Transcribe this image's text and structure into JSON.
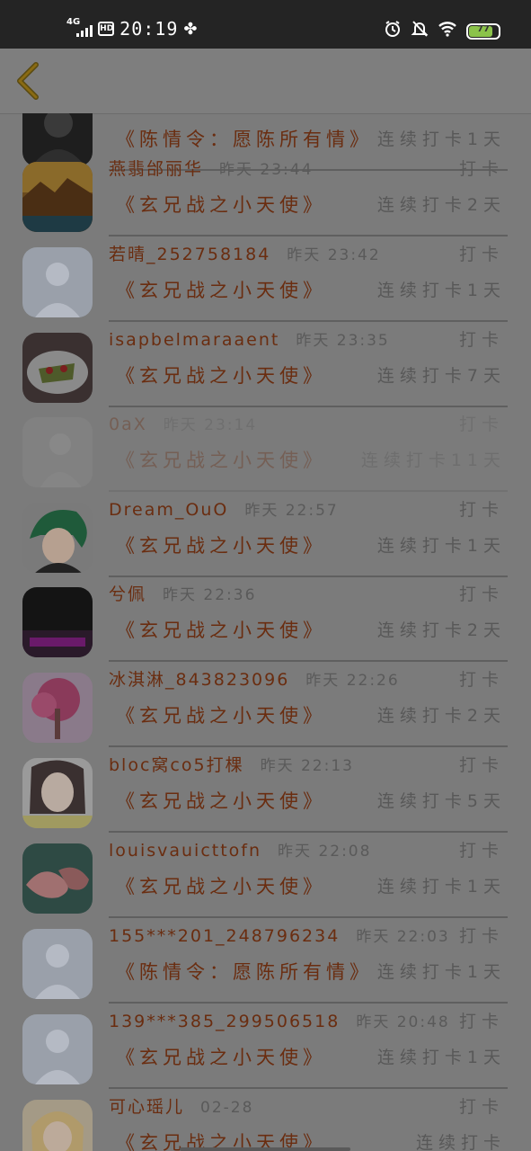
{
  "status_bar": {
    "network": "4G",
    "hd": "HD",
    "time": "20:19",
    "battery": "77",
    "battery_level": 0.77
  },
  "header": {
    "back_icon": "chevron-left-icon",
    "back_color": "#8a6a12"
  },
  "list": [
    {
      "avatar": "dark-portrait",
      "name": "",
      "time": "",
      "action": "",
      "book": "《陈情令：愿陈所有情》",
      "streak": "连续打卡1天"
    },
    {
      "avatar": "landscape-cliff",
      "name": "燕翡邰丽华",
      "time": "昨天 23:44",
      "action": "打卡",
      "book": "《玄兄战之小天使》",
      "streak": "连续打卡2天"
    },
    {
      "avatar": "default-user",
      "name": "若晴_252758184",
      "time": "昨天 23:42",
      "action": "打卡",
      "book": "《玄兄战之小天使》",
      "streak": "连续打卡1天"
    },
    {
      "avatar": "food-plate",
      "name": "isapbelmaraaent",
      "time": "昨天 23:35",
      "action": "打卡",
      "book": "《玄兄战之小天使》",
      "streak": "连续打卡7天"
    },
    {
      "avatar": "faded-figure",
      "name": "0aX",
      "time": "昨天 23:14",
      "action": "打卡",
      "book": "《玄兄战之小天使》",
      "streak": "连续打卡11天",
      "faded": true
    },
    {
      "avatar": "green-hair-anime",
      "name": "Dream_OuO",
      "time": "昨天 22:57",
      "action": "打卡",
      "book": "《玄兄战之小天使》",
      "streak": "连续打卡1天"
    },
    {
      "avatar": "night-scene",
      "name": "兮佩",
      "time": "昨天 22:36",
      "action": "打卡",
      "book": "《玄兄战之小天使》",
      "streak": "连续打卡2天"
    },
    {
      "avatar": "pink-tree",
      "name": "冰淇淋_843823096",
      "time": "昨天 22:26",
      "action": "打卡",
      "book": "《玄兄战之小天使》",
      "streak": "连续打卡2天"
    },
    {
      "avatar": "girl-face",
      "name": "bloc窝co5打棵",
      "time": "昨天 22:13",
      "action": "打卡",
      "book": "《玄兄战之小天使》",
      "streak": "连续打卡5天"
    },
    {
      "avatar": "flamingo",
      "name": "louisvauicttofn",
      "time": "昨天 22:08",
      "action": "打卡",
      "book": "《玄兄战之小天使》",
      "streak": "连续打卡1天"
    },
    {
      "avatar": "default-user",
      "name": "155***201_248796234",
      "time": "昨天 22:03",
      "action": "打卡",
      "book": "《陈情令：愿陈所有情》",
      "streak": "连续打卡1天"
    },
    {
      "avatar": "default-user",
      "name": "139***385_299506518",
      "time": "昨天 20:48",
      "action": "打卡",
      "book": "《玄兄战之小天使》",
      "streak": "连续打卡1天"
    },
    {
      "avatar": "anime-girl-pink",
      "name": "可心瑶儿",
      "time": "02-28",
      "action": "打卡",
      "book": "《玄兄战之小天使》",
      "streak": "连续打卡"
    }
  ]
}
